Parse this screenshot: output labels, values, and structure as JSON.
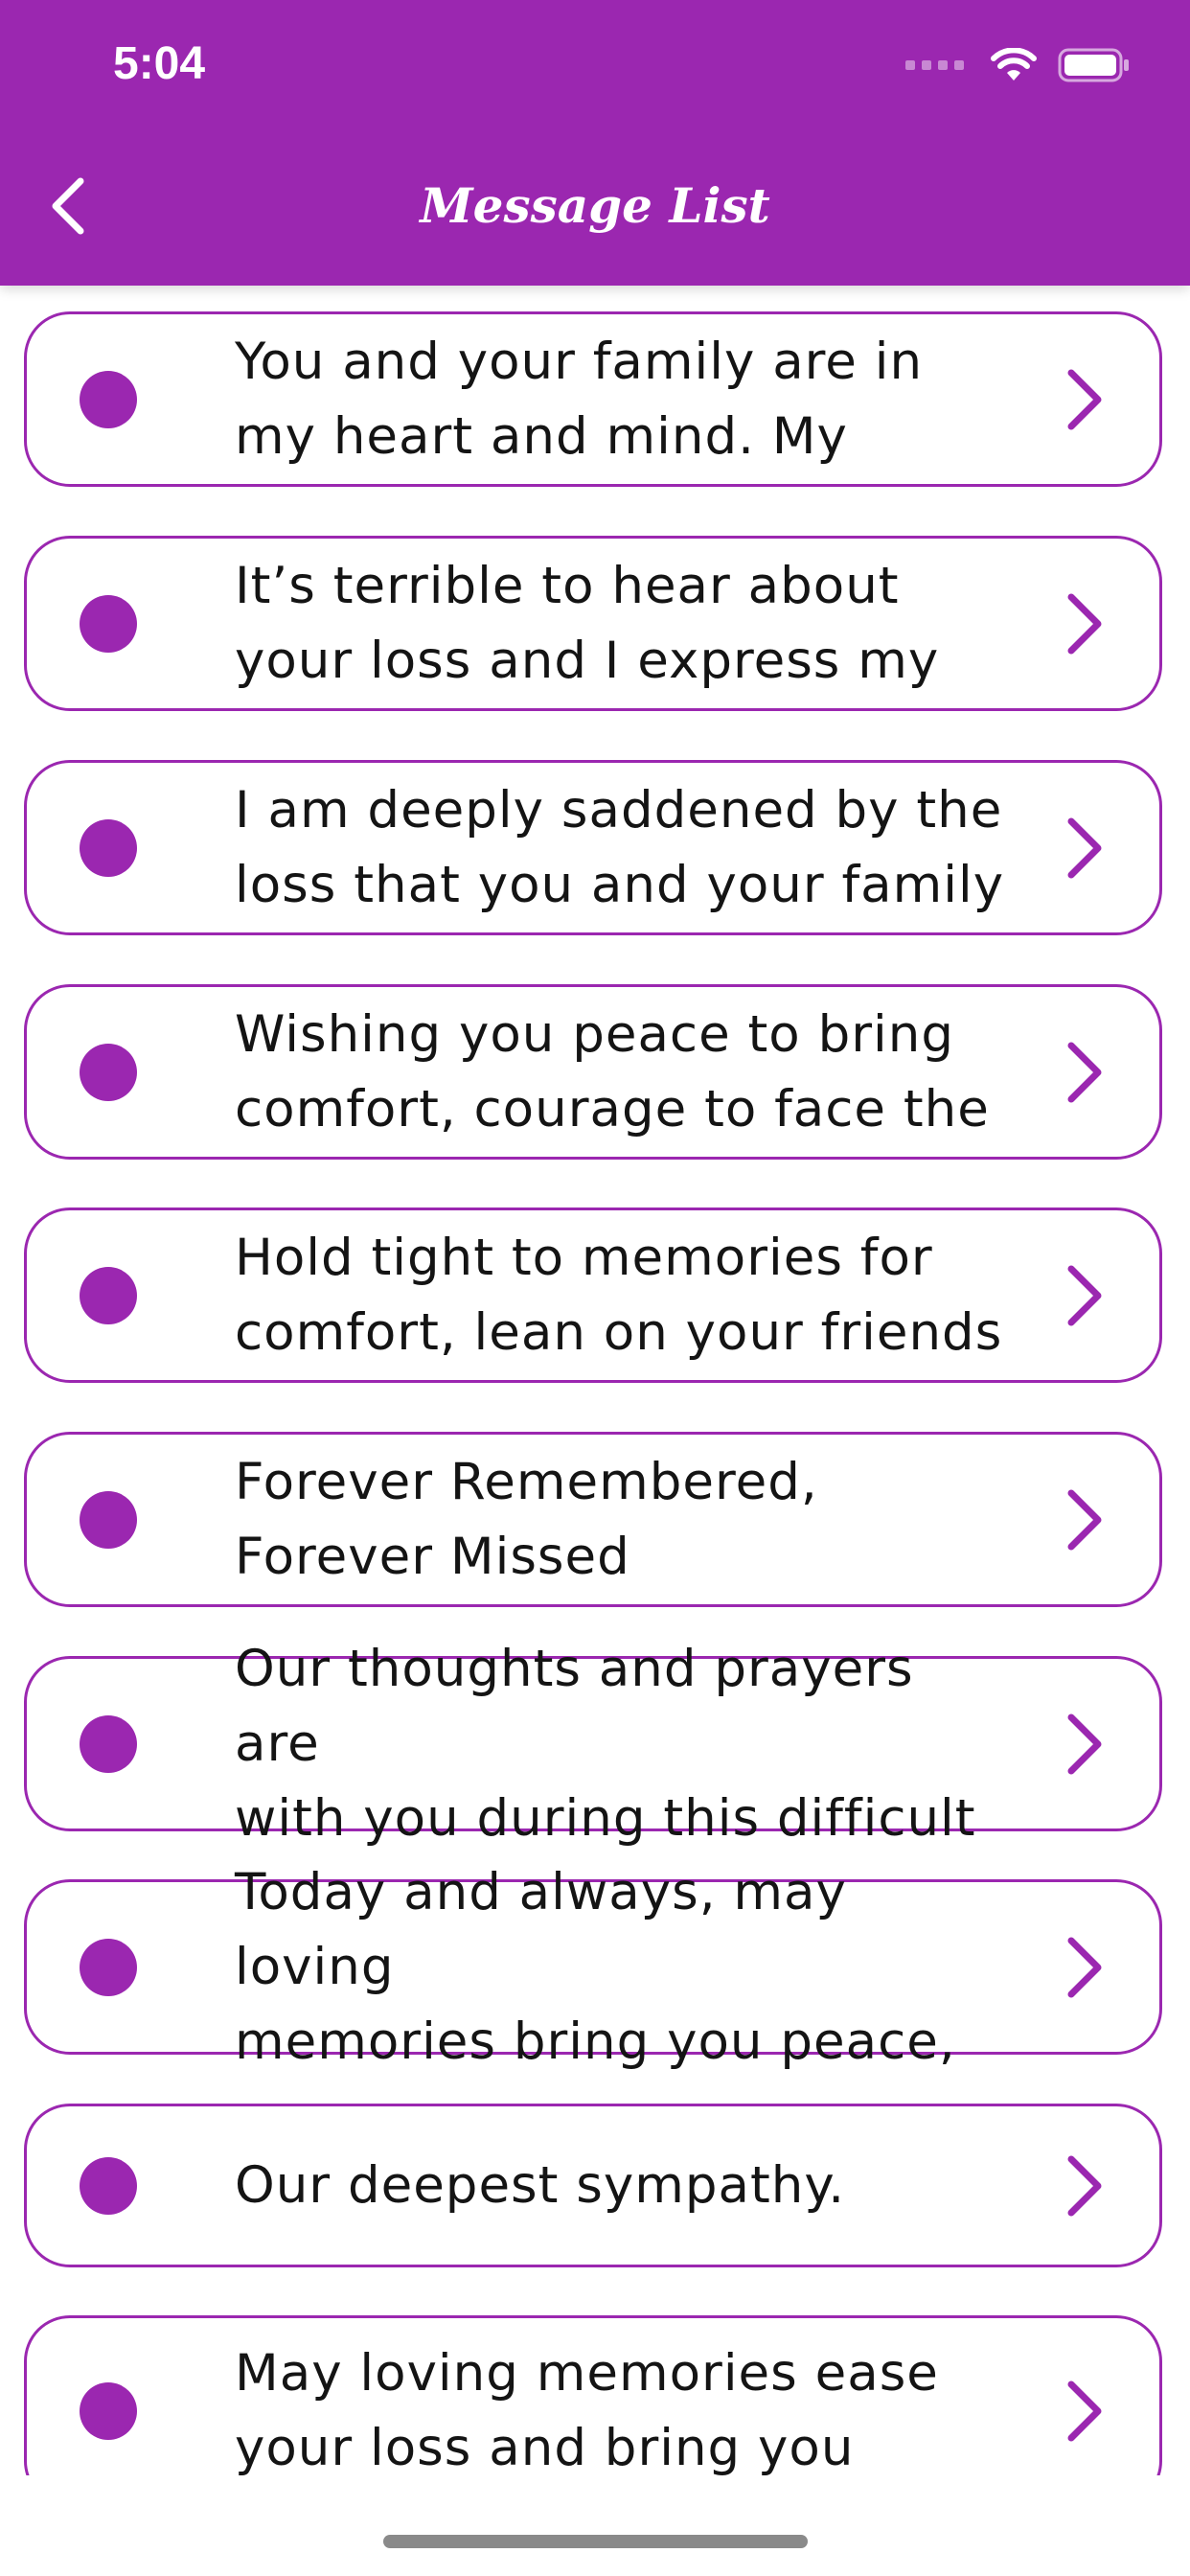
{
  "status_bar": {
    "time": "5:04"
  },
  "header": {
    "title": "Message List",
    "back_icon": "chevron-left-icon"
  },
  "colors": {
    "accent": "#9b27b0",
    "text": "#141414",
    "background": "#ffffff"
  },
  "messages": [
    {
      "text": "You and your family are in\nmy heart and mind. My"
    },
    {
      "text": "It’s terrible to hear about\nyour loss and I express my"
    },
    {
      "text": "I am deeply saddened by the\nloss that you and your family"
    },
    {
      "text": "Wishing you peace to bring\ncomfort, courage to face the"
    },
    {
      "text": "Hold tight to memories for\ncomfort, lean on your friends"
    },
    {
      "text": "Forever Remembered,\nForever Missed"
    },
    {
      "text": "Our thoughts and prayers are\nwith you during this difficult"
    },
    {
      "text": "Today and always, may loving\nmemories bring you peace,"
    },
    {
      "text": "Our deepest sympathy."
    },
    {
      "text": "May loving memories ease\nyour loss and bring you"
    }
  ]
}
